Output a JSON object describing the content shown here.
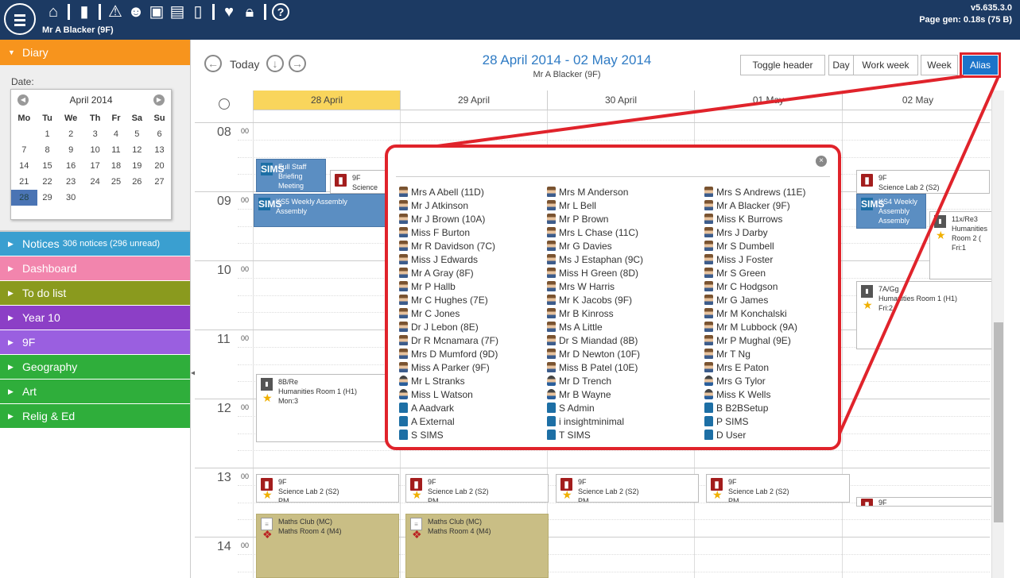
{
  "topbar": {
    "user": "Mr A Blacker (9F)",
    "version": "v5.635.3.0",
    "page_gen": "Page gen: 0.18s (75 B)",
    "icons": [
      "menu-icon",
      "home-icon",
      "book-icon",
      "warning-icon",
      "person-search-icon",
      "id-card-icon",
      "printer-icon",
      "phone-icon",
      "heart-icon",
      "lock-icon",
      "help-icon"
    ]
  },
  "sidebar": {
    "diary": {
      "label": "Diary",
      "date_label": "Date:",
      "calendar": {
        "month": "April 2014",
        "weekdays": [
          "Mo",
          "Tu",
          "We",
          "Th",
          "Fr",
          "Sa",
          "Su"
        ],
        "weeks": [
          [
            "",
            "",
            "",
            "",
            "",
            "",
            ""
          ],
          [
            "",
            "1",
            "2",
            "3",
            "4",
            "5",
            "6"
          ],
          [
            "7",
            "8",
            "9",
            "10",
            "11",
            "12",
            "13"
          ],
          [
            "14",
            "15",
            "16",
            "17",
            "18",
            "19",
            "20"
          ],
          [
            "21",
            "22",
            "23",
            "24",
            "25",
            "26",
            "27"
          ],
          [
            "28",
            "29",
            "30",
            "",
            "",
            "",
            ""
          ]
        ],
        "selected": "28"
      }
    },
    "items": [
      {
        "label": "Notices",
        "extra": "306 notices (296 unread)",
        "color": "#3a9fd0"
      },
      {
        "label": "Dashboard",
        "extra": "",
        "color": "#f285ad"
      },
      {
        "label": "To do list",
        "extra": "",
        "color": "#8a9a1e"
      },
      {
        "label": "Year 10",
        "extra": "",
        "color": "#8c3fc6"
      },
      {
        "label": "9F",
        "extra": "",
        "color": "#9a5fe0"
      },
      {
        "label": "Geography",
        "extra": "",
        "color": "#2fae3b"
      },
      {
        "label": "Art",
        "extra": "",
        "color": "#2fae3b"
      },
      {
        "label": "Relig & Ed",
        "extra": "",
        "color": "#2fae3b"
      }
    ]
  },
  "toolbar": {
    "today": "Today",
    "title": "28 April 2014 - 02 May 2014",
    "subtitle": "Mr A Blacker (9F)",
    "toggle_header": "Toggle header",
    "day": "Day",
    "work_week": "Work week",
    "week": "Week",
    "alias": "Alias"
  },
  "days": [
    "28 April",
    "29 April",
    "30 April",
    "01 May",
    "02 May"
  ],
  "hours": [
    "08",
    "09",
    "10",
    "11",
    "12",
    "13",
    "14"
  ],
  "minute_label": "00",
  "events": {
    "staff_briefing": "Full Staff Briefing Meeting",
    "ks5_title": "KS5 Weekly Assembly",
    "ks5_sub": "Assembly",
    "ks4_title": "KS4 Weekly Assembly",
    "ks4_sub": "Assembly",
    "sci_9f_a": "9F",
    "sci_9f_a_room": "Science L",
    "sci_9f_fri": "9F",
    "sci_9f_fri_room": "Science Lab 2 (S2)",
    "hum_11x": "11x/Re3",
    "hum_11x_room": "Humanities Room 2 (",
    "hum_11x_period": "Fri:1",
    "hum_7a": "7A/Gg",
    "hum_7a_room": "Humanities Room 1 (H1)",
    "hum_7a_period": "Fri:2",
    "hum_8b": "8B/Re",
    "hum_8b_room": "Humanities Room 1 (H1)",
    "hum_8b_period": "Mon:3",
    "pm_class": "9F",
    "pm_room": "Science Lab 2 (S2)",
    "pm_period": "PM",
    "pm_fri_class": "9F",
    "maths_club": "Maths Club (MC)",
    "maths_room": "Maths Room 4 (M4)"
  },
  "alias_popup": {
    "close": "×",
    "columns": [
      [
        {
          "name": "Mrs A Abell (11D)",
          "type": "person"
        },
        {
          "name": "Mr J Atkinson",
          "type": "person"
        },
        {
          "name": "Mr J Brown (10A)",
          "type": "person"
        },
        {
          "name": "Miss F Burton",
          "type": "person"
        },
        {
          "name": "Mr R Davidson (7C)",
          "type": "person"
        },
        {
          "name": "Miss J Edwards",
          "type": "person"
        },
        {
          "name": "Mr A Gray (8F)",
          "type": "person"
        },
        {
          "name": "Mr P Hallb",
          "type": "person"
        },
        {
          "name": "Mr C Hughes (7E)",
          "type": "person"
        },
        {
          "name": "Mr C Jones",
          "type": "person"
        },
        {
          "name": "Dr J Lebon (8E)",
          "type": "person"
        },
        {
          "name": "Dr R Mcnamara (7F)",
          "type": "person"
        },
        {
          "name": "Mrs D Mumford (9D)",
          "type": "person"
        },
        {
          "name": "Miss A Parker (9F)",
          "type": "person"
        },
        {
          "name": "Mr L Stranks",
          "type": "person2"
        },
        {
          "name": "Miss L Watson",
          "type": "person2"
        },
        {
          "name": "A Aadvark",
          "type": "sims"
        },
        {
          "name": "A External",
          "type": "sims"
        },
        {
          "name": "S SIMS",
          "type": "sims"
        }
      ],
      [
        {
          "name": "Mrs M Anderson",
          "type": "person"
        },
        {
          "name": "Mr L Bell",
          "type": "person"
        },
        {
          "name": "Mr P Brown",
          "type": "person"
        },
        {
          "name": "Mrs L Chase (11C)",
          "type": "person"
        },
        {
          "name": "Mr G Davies",
          "type": "person"
        },
        {
          "name": "Ms J Estaphan (9C)",
          "type": "person"
        },
        {
          "name": "Miss H Green (8D)",
          "type": "person"
        },
        {
          "name": "Mrs W Harris",
          "type": "person"
        },
        {
          "name": "Mr K Jacobs (9F)",
          "type": "person"
        },
        {
          "name": "Mr B Kinross",
          "type": "person"
        },
        {
          "name": "Ms A Little",
          "type": "person"
        },
        {
          "name": "Dr S Miandad (8B)",
          "type": "person"
        },
        {
          "name": "Mr D Newton (10F)",
          "type": "person"
        },
        {
          "name": "Miss B Patel (10E)",
          "type": "person"
        },
        {
          "name": "Mr D Trench",
          "type": "person2"
        },
        {
          "name": "Mr B Wayne",
          "type": "person2"
        },
        {
          "name": "S Admin",
          "type": "sims"
        },
        {
          "name": "i insightminimal",
          "type": "sims"
        },
        {
          "name": "T SIMS",
          "type": "sims"
        }
      ],
      [
        {
          "name": "Mrs S Andrews (11E)",
          "type": "person"
        },
        {
          "name": "Mr A Blacker (9F)",
          "type": "person"
        },
        {
          "name": "Miss K Burrows",
          "type": "person"
        },
        {
          "name": "Mrs J Darby",
          "type": "person"
        },
        {
          "name": "Mr S Dumbell",
          "type": "person"
        },
        {
          "name": "Miss J Foster",
          "type": "person"
        },
        {
          "name": "Mr S Green",
          "type": "person"
        },
        {
          "name": "Mr C Hodgson",
          "type": "person"
        },
        {
          "name": "Mr G James",
          "type": "person"
        },
        {
          "name": "Mr M Konchalski",
          "type": "person"
        },
        {
          "name": "Mr M Lubbock (9A)",
          "type": "person"
        },
        {
          "name": "Mr P Mughal (9E)",
          "type": "person"
        },
        {
          "name": "Mr T Ng",
          "type": "person"
        },
        {
          "name": "Mrs E Paton",
          "type": "person"
        },
        {
          "name": "Mrs G Tylor",
          "type": "person2"
        },
        {
          "name": "Miss K Wells",
          "type": "person2"
        },
        {
          "name": "B B2BSetup",
          "type": "sims"
        },
        {
          "name": "P SIMS",
          "type": "sims"
        },
        {
          "name": "D User",
          "type": "sims"
        }
      ]
    ]
  },
  "colors": {
    "topbar": "#1c3a63",
    "accent": "#1b74c9",
    "highlight": "#e0232b",
    "today": "#f9d55c"
  }
}
